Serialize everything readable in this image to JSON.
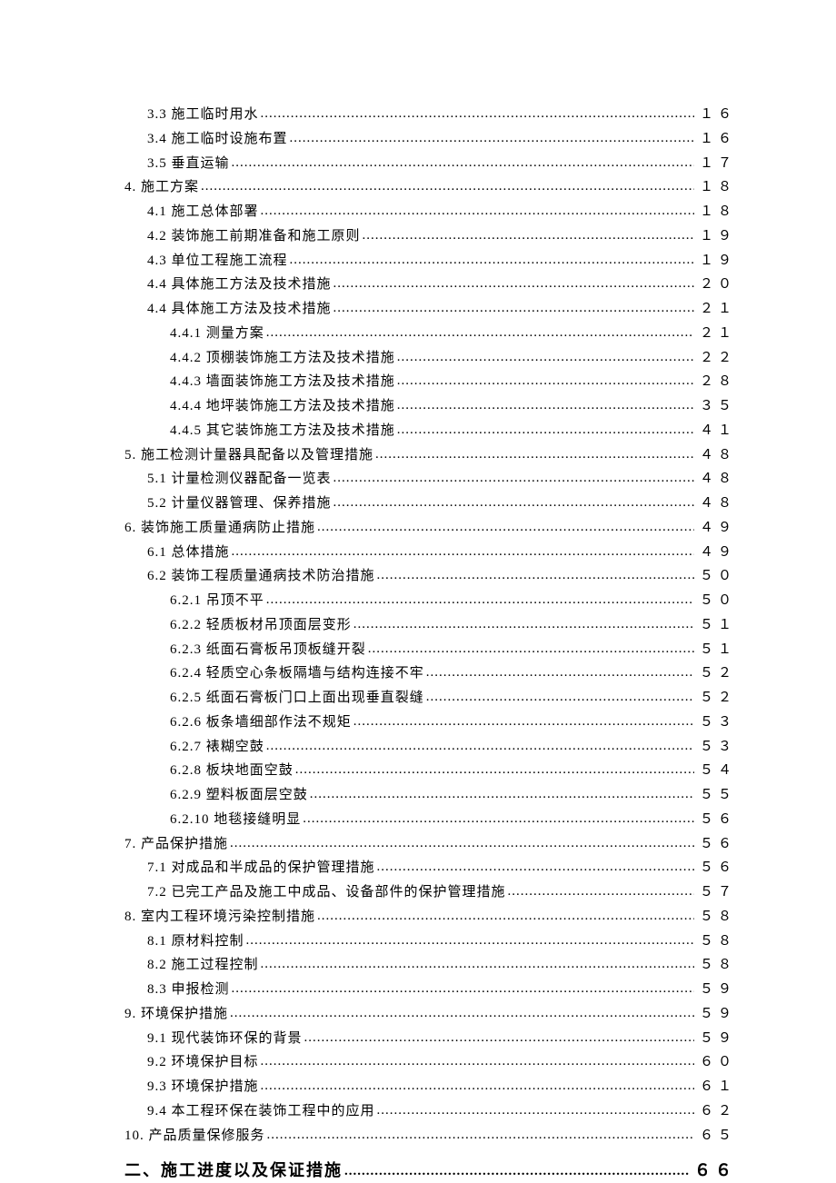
{
  "toc": [
    {
      "label": "3.3 施工临时用水",
      "page": "１６",
      "indent": 1,
      "heading": false
    },
    {
      "label": "3.4 施工临时设施布置",
      "page": "１６",
      "indent": 1,
      "heading": false
    },
    {
      "label": "3.5 垂直运输",
      "page": "１７",
      "indent": 1,
      "heading": false
    },
    {
      "label": "4. 施工方案",
      "page": "１８",
      "indent": 0,
      "heading": false
    },
    {
      "label": "4.1 施工总体部署",
      "page": "１８",
      "indent": 1,
      "heading": false
    },
    {
      "label": "4.2 装饰施工前期准备和施工原则",
      "page": "１９",
      "indent": 1,
      "heading": false
    },
    {
      "label": "4.3 单位工程施工流程",
      "page": "１９",
      "indent": 1,
      "heading": false
    },
    {
      "label": "4.4 具体施工方法及技术措施",
      "page": "２０",
      "indent": 1,
      "heading": false
    },
    {
      "label": "4.4 具体施工方法及技术措施",
      "page": "２１",
      "indent": 1,
      "heading": false
    },
    {
      "label": "4.4.1 测量方案",
      "page": "２１",
      "indent": 2,
      "heading": false
    },
    {
      "label": "4.4.2 顶棚装饰施工方法及技术措施",
      "page": "２２",
      "indent": 2,
      "heading": false
    },
    {
      "label": "4.4.3 墙面装饰施工方法及技术措施",
      "page": "２８",
      "indent": 2,
      "heading": false
    },
    {
      "label": "4.4.4 地坪装饰施工方法及技术措施",
      "page": "３５",
      "indent": 2,
      "heading": false
    },
    {
      "label": "4.4.5 其它装饰施工方法及技术措施",
      "page": "４１",
      "indent": 2,
      "heading": false
    },
    {
      "label": "5. 施工检测计量器具配备以及管理措施",
      "page": "４８",
      "indent": 0,
      "heading": false
    },
    {
      "label": "5.1 计量检测仪器配备一览表",
      "page": "４８",
      "indent": 1,
      "heading": false
    },
    {
      "label": "5.2 计量仪器管理、保养措施",
      "page": "４８",
      "indent": 1,
      "heading": false
    },
    {
      "label": "6. 装饰施工质量通病防止措施",
      "page": "４９",
      "indent": 0,
      "heading": false
    },
    {
      "label": "6.1 总体措施",
      "page": "４９",
      "indent": 1,
      "heading": false
    },
    {
      "label": "6.2 装饰工程质量通病技术防治措施",
      "page": "５０",
      "indent": 1,
      "heading": false
    },
    {
      "label": "6.2.1 吊顶不平",
      "page": "５０",
      "indent": 2,
      "heading": false
    },
    {
      "label": "6.2.2 轻质板材吊顶面层变形",
      "page": "５１",
      "indent": 2,
      "heading": false
    },
    {
      "label": "6.2.3 纸面石膏板吊顶板缝开裂",
      "page": "５１",
      "indent": 2,
      "heading": false
    },
    {
      "label": "6.2.4 轻质空心条板隔墙与结构连接不牢",
      "page": "５２",
      "indent": 2,
      "heading": false
    },
    {
      "label": "6.2.5 纸面石膏板门口上面出现垂直裂缝",
      "page": "５２",
      "indent": 2,
      "heading": false
    },
    {
      "label": "6.2.6 板条墙细部作法不规矩",
      "page": "５３",
      "indent": 2,
      "heading": false
    },
    {
      "label": "6.2.7 裱糊空鼓",
      "page": "５３",
      "indent": 2,
      "heading": false
    },
    {
      "label": "6.2.8 板块地面空鼓",
      "page": "５４",
      "indent": 2,
      "heading": false
    },
    {
      "label": "6.2.9 塑料板面层空鼓",
      "page": "５５",
      "indent": 2,
      "heading": false
    },
    {
      "label": "6.2.10 地毯接缝明显",
      "page": "５６",
      "indent": 2,
      "heading": false
    },
    {
      "label": "7. 产品保护措施",
      "page": "５６",
      "indent": 0,
      "heading": false
    },
    {
      "label": "7.1 对成品和半成品的保护管理措施",
      "page": "５６",
      "indent": 1,
      "heading": false
    },
    {
      "label": "7.2 已完工产品及施工中成品、设备部件的保护管理措施",
      "page": "５７",
      "indent": 1,
      "heading": false
    },
    {
      "label": "8. 室内工程环境污染控制措施",
      "page": "５８",
      "indent": 0,
      "heading": false
    },
    {
      "label": "8.1 原材料控制",
      "page": "５８",
      "indent": 1,
      "heading": false
    },
    {
      "label": "8.2 施工过程控制",
      "page": "５８",
      "indent": 1,
      "heading": false
    },
    {
      "label": "8.3 申报检测",
      "page": "５９",
      "indent": 1,
      "heading": false
    },
    {
      "label": "9. 环境保护措施",
      "page": "５９",
      "indent": 0,
      "heading": false
    },
    {
      "label": "9.1 现代装饰环保的背景",
      "page": "５９",
      "indent": 1,
      "heading": false
    },
    {
      "label": "9.2 环境保护目标",
      "page": "６０",
      "indent": 1,
      "heading": false
    },
    {
      "label": "9.3 环境保护措施",
      "page": "６１",
      "indent": 1,
      "heading": false
    },
    {
      "label": "9.4 本工程环保在装饰工程中的应用",
      "page": "６２",
      "indent": 1,
      "heading": false
    },
    {
      "label": "10. 产品质量保修服务",
      "page": "６５",
      "indent": 0,
      "heading": false
    },
    {
      "label": "二、施工进度以及保证措施",
      "page": "６６",
      "indent": 0,
      "heading": true
    }
  ]
}
